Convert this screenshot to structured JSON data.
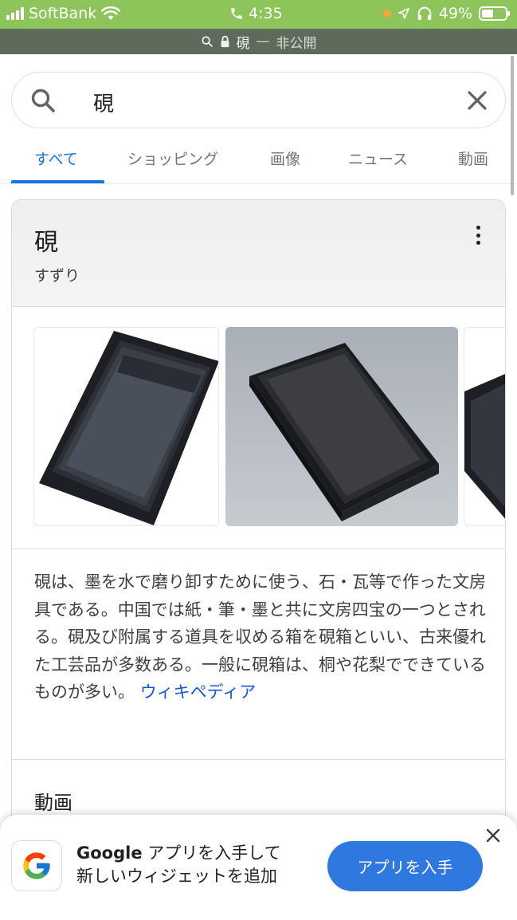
{
  "status_bar": {
    "carrier": "SoftBank",
    "time": "4:35",
    "battery": "49%",
    "battery_level": 0.49
  },
  "url_bar": {
    "title": "硯",
    "separator": "—",
    "mode": "非公開"
  },
  "search": {
    "query": "硯"
  },
  "tabs": [
    {
      "label": "すべて",
      "active": true
    },
    {
      "label": "ショッピング",
      "active": false
    },
    {
      "label": "画像",
      "active": false
    },
    {
      "label": "ニュース",
      "active": false
    },
    {
      "label": "動画",
      "active": false
    }
  ],
  "knowledge_panel": {
    "title": "硯",
    "reading": "すずり",
    "description": "硯は、墨を水で磨り卸すために使う、石・瓦等で作った文房具である。中国では紙・筆・墨と共に文房四宝の一つとされる。硯及び附属する道具を収める箱を硯箱といい、古来優れた工芸品が多数ある。一般に硯箱は、桐や花梨でできているものが多い。",
    "source_link": "ウィキペディア",
    "section_heading": "動画"
  },
  "app_banner": {
    "brand": "Google",
    "line1_rest": " アプリを入手して",
    "line2": "新しいウィジェットを追加",
    "button": "アプリを入手"
  },
  "colors": {
    "status_bar": "#8ec55a",
    "accent": "#1a73e8",
    "button": "#2f78e0"
  }
}
